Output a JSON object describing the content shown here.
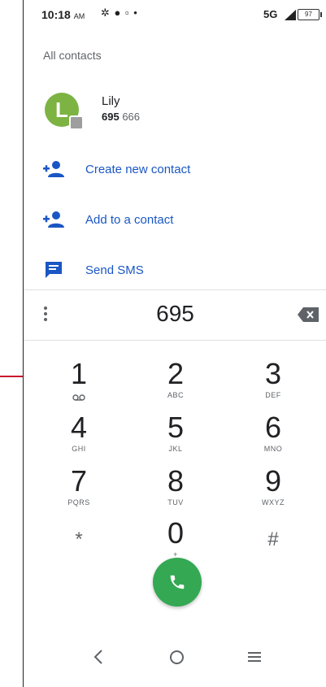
{
  "status_bar": {
    "time": "10:18",
    "ampm": "AM",
    "icons": "✲ ● ▫ •",
    "network": "5G",
    "battery": "97"
  },
  "section_title": "All contacts",
  "contact": {
    "initial": "L",
    "name": "Lily",
    "number_match": "695",
    "number_rest": " 666",
    "avatar_color": "#7cb342"
  },
  "actions": [
    {
      "label": "Create new contact",
      "icon": "add-person-icon"
    },
    {
      "label": "Add to a contact",
      "icon": "add-person-icon"
    },
    {
      "label": "Send SMS",
      "icon": "message-icon"
    }
  ],
  "dialed_number": "695",
  "keypad": [
    {
      "digit": "1",
      "letters": "voicemail"
    },
    {
      "digit": "2",
      "letters": "ABC"
    },
    {
      "digit": "3",
      "letters": "DEF"
    },
    {
      "digit": "4",
      "letters": "GHI"
    },
    {
      "digit": "5",
      "letters": "JKL"
    },
    {
      "digit": "6",
      "letters": "MNO"
    },
    {
      "digit": "7",
      "letters": "PQRS"
    },
    {
      "digit": "8",
      "letters": "TUV"
    },
    {
      "digit": "9",
      "letters": "WXYZ"
    },
    {
      "digit": "*",
      "letters": ""
    },
    {
      "digit": "0",
      "letters": "+"
    },
    {
      "digit": "#",
      "letters": ""
    }
  ],
  "colors": {
    "accent_blue": "#1a56c4",
    "call_green": "#34a853",
    "callout_red": "#c8102e"
  }
}
